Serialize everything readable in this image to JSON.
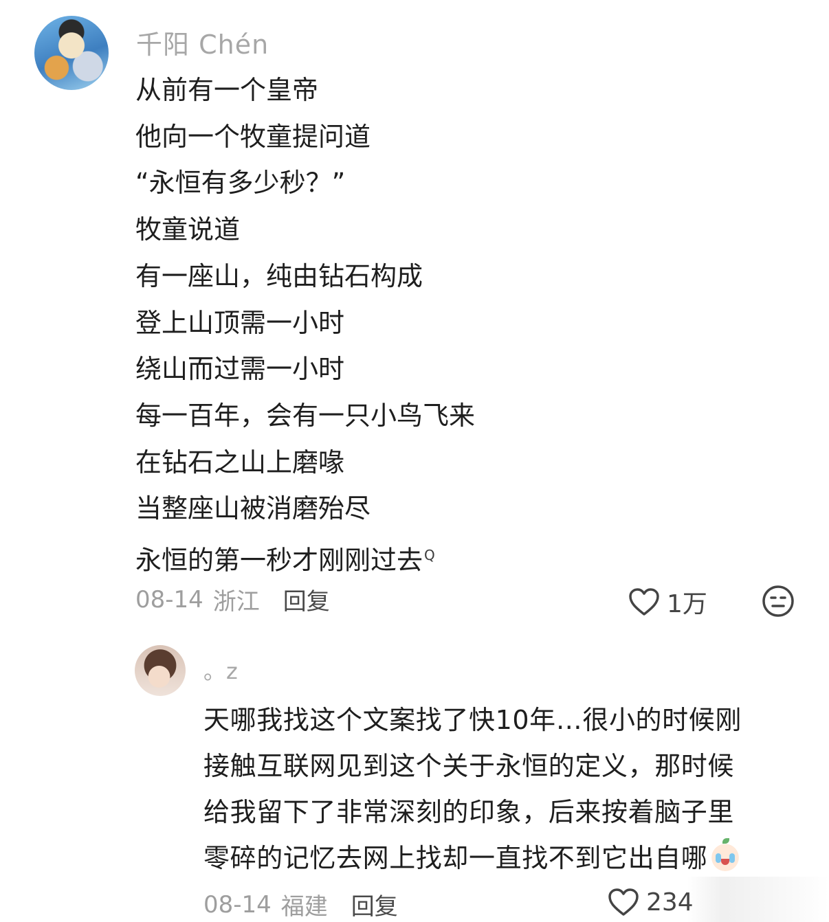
{
  "comment1": {
    "username": "千阳 Chén",
    "lines": [
      "从前有一个皇帝",
      "他向一个牧童提问道",
      "“永恒有多少秒？”",
      "牧童说道",
      "有一座山，纯由钻石构成",
      "登上山顶需一小时",
      "绕山而过需一小时",
      "每一百年，会有一只小鸟飞来",
      "在钻石之山上磨喙",
      "当整座山被消磨殆尽",
      "永恒的第一秒才刚刚过去"
    ],
    "search_marker": "Q",
    "date": "08-14",
    "location": "浙江",
    "reply_label": "回复",
    "like_count": "1万"
  },
  "comment2": {
    "username": "。z",
    "lines": [
      "天哪我找这个文案找了快10年…很小的时候刚",
      "接触互联网见到这个关于永恒的定义，那时候",
      "给我留下了非常深刻的印象，后来按着脑子里",
      "零碎的记忆去网上找却一直找不到它出自哪"
    ],
    "date": "08-14",
    "location": "福建",
    "reply_label": "回复",
    "like_count": "234"
  },
  "icons": {
    "like": "heart-outline-icon",
    "dislike": "meh-face-icon",
    "emoji": "crying-baby-emoji"
  },
  "colors": {
    "meta_gray": "#9e9e9e",
    "text": "#1e1e1e"
  }
}
